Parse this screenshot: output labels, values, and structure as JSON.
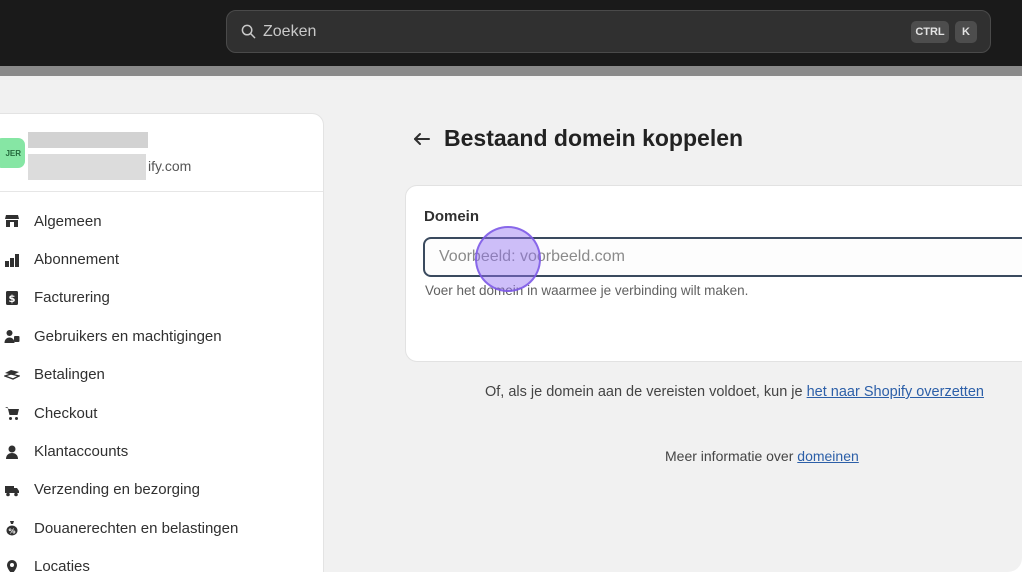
{
  "topbar": {
    "search_placeholder": "Zoeken",
    "shortcut_ctrl": "CTRL",
    "shortcut_k": "K"
  },
  "store": {
    "avatar_text": "JER",
    "domain_suffix": "ify.com"
  },
  "sidebar": {
    "items": [
      {
        "label": "Algemeen",
        "icon": "store-icon"
      },
      {
        "label": "Abonnement",
        "icon": "plan-icon"
      },
      {
        "label": "Facturering",
        "icon": "billing-icon"
      },
      {
        "label": "Gebruikers en machtigingen",
        "icon": "users-icon"
      },
      {
        "label": "Betalingen",
        "icon": "payments-icon"
      },
      {
        "label": "Checkout",
        "icon": "cart-icon"
      },
      {
        "label": "Klantaccounts",
        "icon": "person-icon"
      },
      {
        "label": "Verzending en bezorging",
        "icon": "truck-icon"
      },
      {
        "label": "Douanerechten en belastingen",
        "icon": "tax-icon"
      },
      {
        "label": "Locaties",
        "icon": "location-icon"
      }
    ]
  },
  "main": {
    "title": "Bestaand domein koppelen",
    "field_label": "Domein",
    "field_placeholder": "Voorbeeld: voorbeeld.com",
    "field_value": "",
    "field_help": "Voer het domein in waarmee je verbinding wilt maken.",
    "or_text": "Of, als je domein aan de vereisten voldoet, kun je ",
    "or_link": "het naar Shopify overzetten",
    "info_text": "Meer informatie over ",
    "info_link": "domeinen"
  },
  "colors": {
    "topbar_bg": "#1a1a1a",
    "avatar_bg": "#86e6a4",
    "link": "#2c5fa8",
    "cursor": "#9270f2"
  }
}
